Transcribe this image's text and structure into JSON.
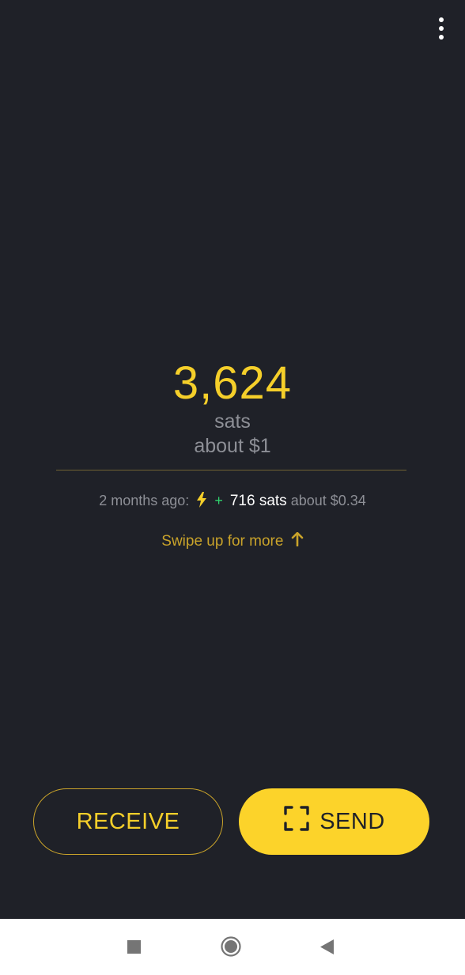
{
  "balance": {
    "amount": "3,624",
    "unit": "sats",
    "fiat": "about $1"
  },
  "last_transaction": {
    "time": "2 months ago:",
    "type_icon": "lightning-bolt-icon",
    "sign": "+",
    "amount": "716 sats",
    "fiat": "about $0.34"
  },
  "hint": {
    "text": "Swipe up for more",
    "icon": "arrow-up-icon"
  },
  "actions": {
    "receive_label": "RECEIVE",
    "send_label": "SEND",
    "send_icon": "scan-icon"
  },
  "top_bar": {
    "menu_icon": "more-vertical-icon"
  },
  "system_nav": {
    "recents_icon": "square-icon",
    "home_icon": "circle-icon",
    "back_icon": "triangle-back-icon"
  },
  "colors": {
    "background": "#1f2128",
    "accent": "#f5cf2a",
    "accent_dim": "#c9a32a",
    "muted_text": "#8d8f96",
    "positive": "#2fd46d"
  }
}
